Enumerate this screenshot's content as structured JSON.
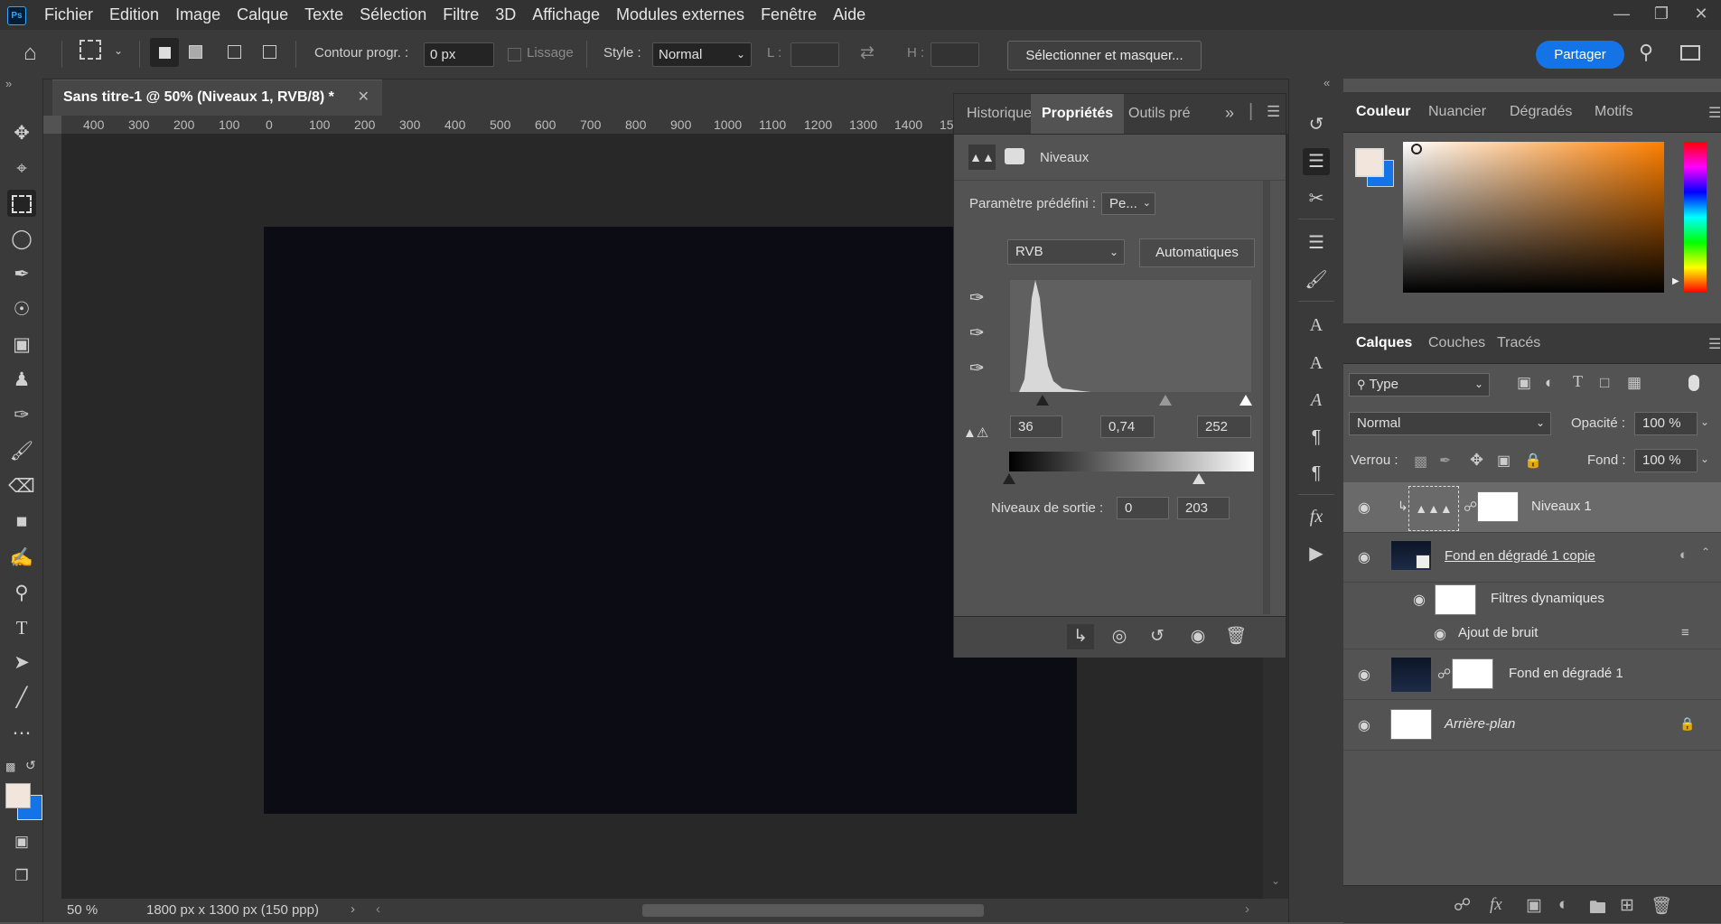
{
  "app": {
    "logo": "Ps"
  },
  "menu": [
    "Fichier",
    "Edition",
    "Image",
    "Calque",
    "Texte",
    "Sélection",
    "Filtre",
    "3D",
    "Affichage",
    "Modules externes",
    "Fenêtre",
    "Aide"
  ],
  "options": {
    "feather_label": "Contour progr. :",
    "feather_value": "0 px",
    "antialias_label": "Lissage",
    "style_label": "Style :",
    "style_value": "Normal",
    "width_label": "L :",
    "height_label": "H :",
    "select_mask": "Sélectionner et masquer...",
    "share": "Partager"
  },
  "document": {
    "tab_title": "Sans titre-1 @ 50% (Niveaux 1, RVB/8) *",
    "ruler_ticks": [
      "400",
      "300",
      "200",
      "100",
      "0",
      "100",
      "200",
      "300",
      "400",
      "500",
      "600",
      "700",
      "800",
      "900",
      "1000",
      "1100",
      "1200",
      "1300",
      "1400",
      "15"
    ],
    "zoom": "50 %",
    "size_info": "1800 px x 1300 px (150 ppp)"
  },
  "properties": {
    "tabs": [
      "Historique",
      "Propriétés",
      "Outils pré"
    ],
    "title": "Niveaux",
    "preset_label": "Paramètre prédéfini :",
    "preset_value": "Pe...",
    "channel": "RVB",
    "auto_button": "Automatiques",
    "input_black": "36",
    "input_gamma": "0,74",
    "input_white": "252",
    "output_label": "Niveaux de sortie :",
    "output_black": "0",
    "output_white": "203"
  },
  "color_panel": {
    "tabs": [
      "Couleur",
      "Nuancier",
      "Dégradés",
      "Motifs"
    ],
    "fg_color": "#f2e6dc",
    "bg_color": "#1473e6"
  },
  "layers_panel": {
    "tabs": [
      "Calques",
      "Couches",
      "Tracés"
    ],
    "filter_value": "Type",
    "blend_mode": "Normal",
    "opacity_label": "Opacité :",
    "opacity_value": "100 %",
    "lock_label": "Verrou :",
    "fill_label": "Fond :",
    "fill_value": "100 %",
    "layers": [
      {
        "name": "Niveaux 1"
      },
      {
        "name": "Fond en dégradé 1 copie"
      },
      {
        "name": "Filtres dynamiques"
      },
      {
        "name": "Ajout de bruit"
      },
      {
        "name": "Fond en dégradé 1"
      },
      {
        "name": "Arrière-plan"
      }
    ]
  }
}
